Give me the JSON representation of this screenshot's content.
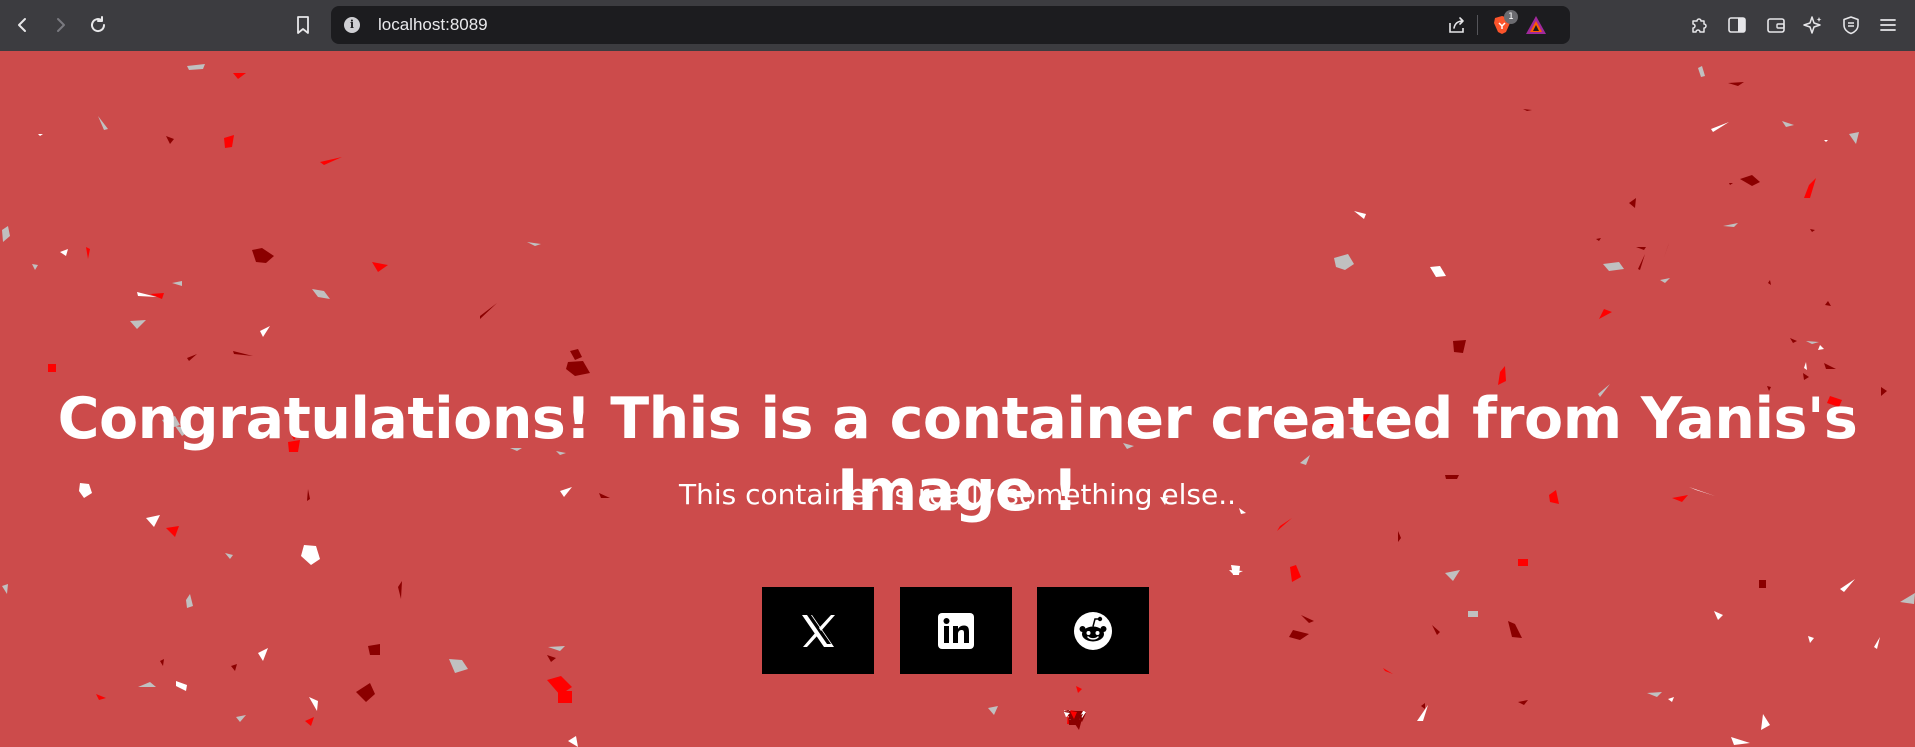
{
  "browser": {
    "url": "localhost:8089",
    "shields_count": "1"
  },
  "page": {
    "title": "Congratulations! This is a container created from Yanis's Image !",
    "subtitle": "This container is really something else..",
    "background_color": "#cc4b4b",
    "social_links": [
      {
        "icon": "x-twitter-icon"
      },
      {
        "icon": "linkedin-icon"
      },
      {
        "icon": "reddit-icon"
      }
    ]
  },
  "colors": {
    "confetti": [
      "#ffffff",
      "#ff0000",
      "#8b0000",
      "#c0c0c0"
    ]
  }
}
